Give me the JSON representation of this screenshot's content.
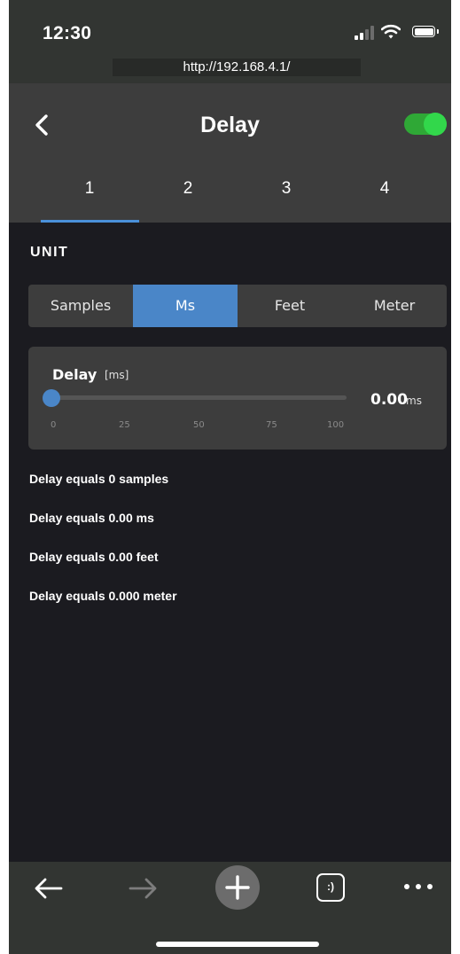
{
  "status_bar": {
    "time": "12:30"
  },
  "browser": {
    "url": "http://192.168.4.1/"
  },
  "header": {
    "title": "Delay",
    "back_icon": "chevron-left-icon",
    "toggle": {
      "on": true,
      "color": "#32d74b"
    }
  },
  "tabs": {
    "items": [
      {
        "label": "1"
      },
      {
        "label": "2"
      },
      {
        "label": "3"
      },
      {
        "label": "4"
      }
    ],
    "active_index": 0,
    "accent": "#4a90d9"
  },
  "unit_section": {
    "label": "UNIT",
    "options": [
      {
        "label": "Samples"
      },
      {
        "label": "Ms"
      },
      {
        "label": "Feet"
      },
      {
        "label": "Meter"
      }
    ],
    "selected": "Ms",
    "accent": "#4a86c8"
  },
  "slider": {
    "label": "Delay",
    "unit": "[ms]",
    "value": 0,
    "value_text": "0.00",
    "value_unit": "ms",
    "min": 0,
    "max": 100,
    "ticks": [
      "0",
      "25",
      "50",
      "75",
      "100"
    ]
  },
  "info_lines": [
    "Delay equals 0 samples",
    "Delay equals 0.00 ms",
    "Delay equals 0.00 feet",
    "Delay equals 0.000 meter"
  ],
  "toolbar": {
    "icons": [
      "back-arrow-icon",
      "forward-arrow-icon",
      "plus-icon",
      "tabs-icon",
      "more-icon"
    ],
    "tabs_glyph": ":)"
  }
}
